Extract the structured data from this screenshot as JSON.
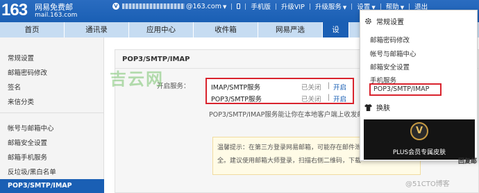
{
  "header": {
    "logo_number": "163",
    "logo_name": "网易免费邮",
    "logo_domain": "mail.163.com",
    "account_suffix": "@163.com",
    "vip_mark": "V",
    "nav": [
      "手机版",
      "升级VIP",
      "升级服务",
      "设置",
      "帮助",
      "退出"
    ]
  },
  "tabs": [
    "首页",
    "通讯录",
    "应用中心",
    "收件箱",
    "网易严选",
    "设"
  ],
  "sidebar": {
    "group1": [
      "常规设置",
      "邮箱密码修改",
      "签名",
      "来信分类"
    ],
    "group2": [
      "帐号与邮箱中心",
      "邮箱安全设置",
      "邮箱手机服务",
      "反垃圾/黑白名单"
    ],
    "active": "POP3/SMTP/IMAP"
  },
  "main": {
    "panel_title": "POP3/SMTP/IMAP",
    "setting_label": "开启服务：",
    "services": [
      {
        "name": "IMAP/SMTP服务",
        "status": "已关闭",
        "sep": "|",
        "action": "开启"
      },
      {
        "name": "POP3/SMTP服务",
        "status": "已关闭",
        "sep": "|",
        "action": "开启"
      }
    ],
    "description": "POP3/SMTP/IMAP服务能让你在本地客户端上收发邮件",
    "notice_line1": "温馨提示：在第三方登录网易邮箱，可能存在邮件泄",
    "notice_line2": "全。建议使用邮箱大师登录，扫描右侧二维码，下载"
  },
  "watermark": "吉云网",
  "dropdown": {
    "header": "常规设置",
    "items": [
      "邮箱密码修改",
      "帐号与邮箱中心",
      "邮箱安全设置",
      "手机服务",
      "POP3/SMTP/IMAP"
    ],
    "skin": "换肤",
    "promo_mark": "V",
    "promo_text": "PLUS会员专属皮肤"
  },
  "footer_watermark": "@51CTO博客",
  "edge_text": "回复邮"
}
